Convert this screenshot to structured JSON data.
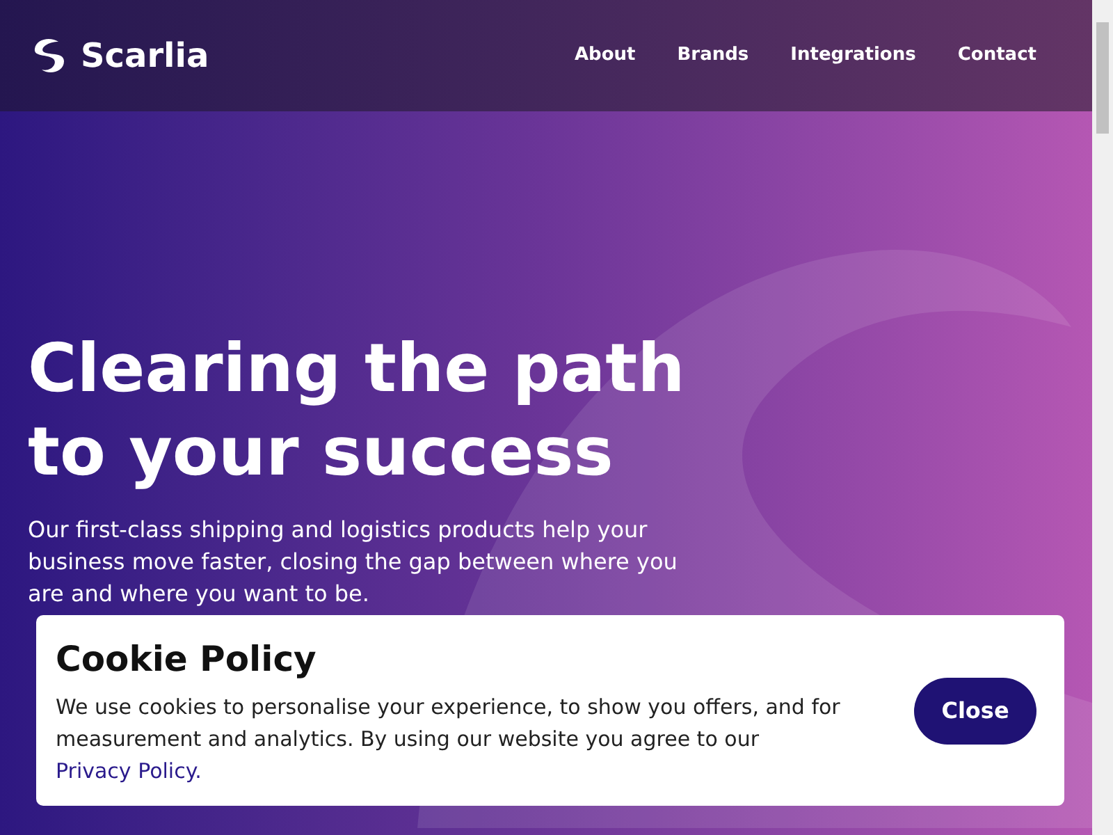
{
  "header": {
    "brand": "Scarlia",
    "nav": [
      {
        "label": "About"
      },
      {
        "label": "Brands"
      },
      {
        "label": "Integrations"
      },
      {
        "label": "Contact"
      }
    ]
  },
  "hero": {
    "headline_lines": [
      "Clearing the path",
      "to your success"
    ],
    "body": "Our first-class shipping and logistics products help your business move faster, closing the gap between where you are and where you want to be."
  },
  "cookie_banner": {
    "title": "Cookie Policy",
    "text": "We use cookies to personalise your experience, to show you offers, and for measurement and analytics. By using our website you agree to our",
    "link": "Privacy Policy.",
    "button": "Close"
  }
}
